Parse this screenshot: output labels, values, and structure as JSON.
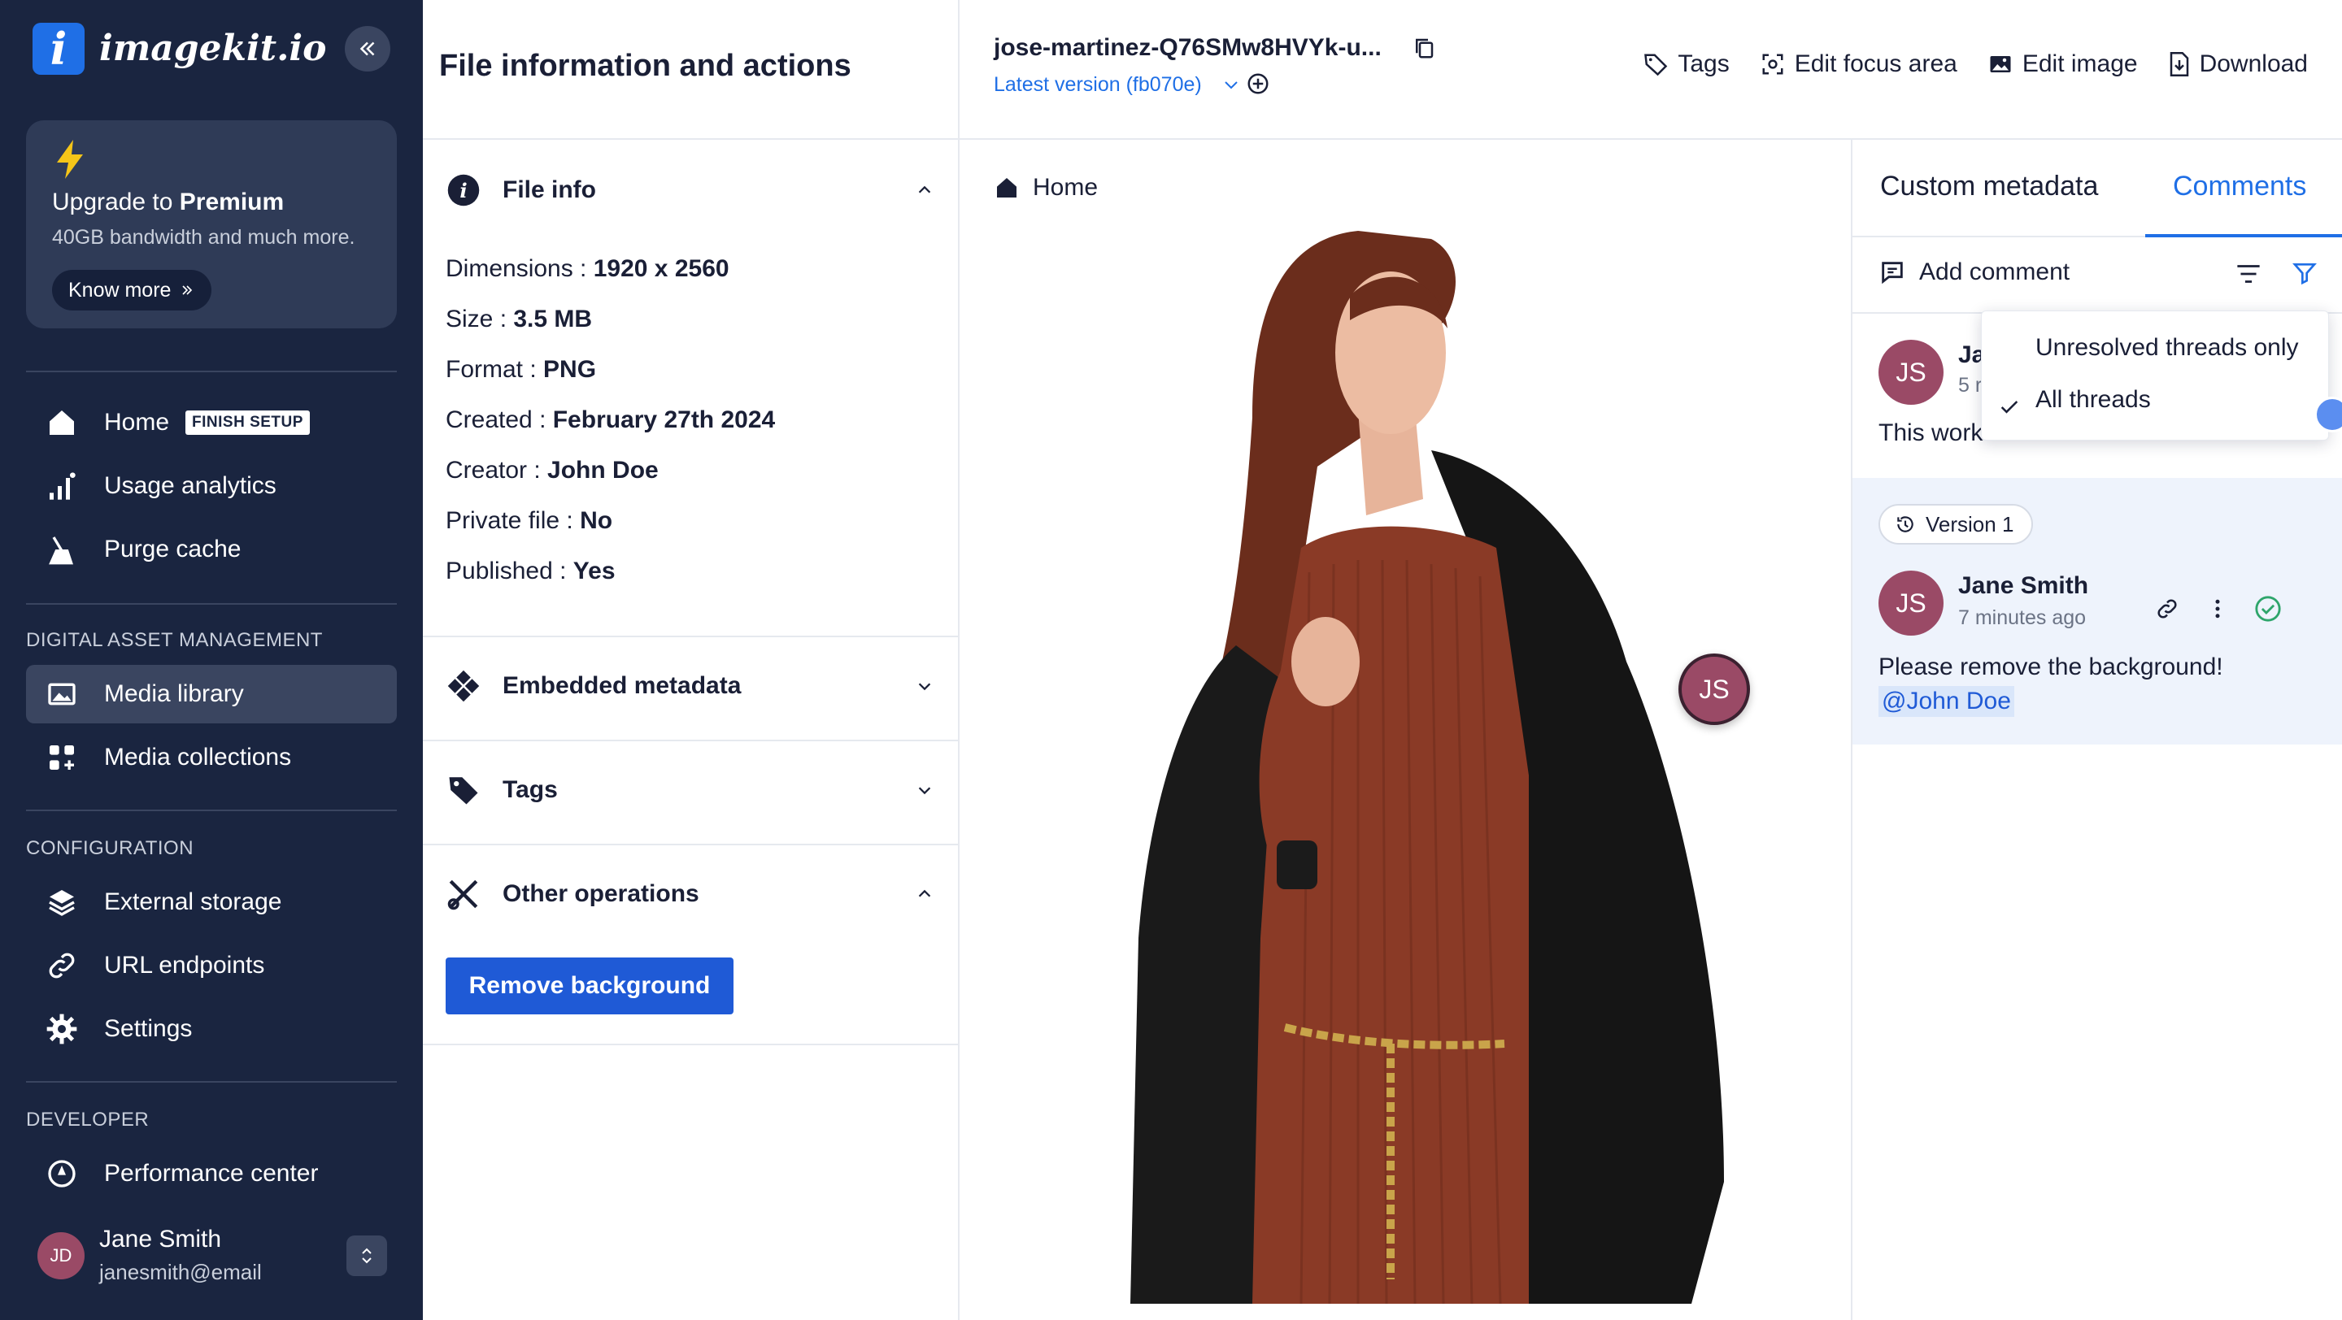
{
  "sidebar": {
    "logo_mark": "i",
    "logo_text": "imagekit.io",
    "upgrade": {
      "title_prefix": "Upgrade to ",
      "title_bold": "Premium",
      "subtitle": "40GB bandwidth and much more.",
      "button": "Know more"
    },
    "nav_main": [
      {
        "label": "Home",
        "badge": "FINISH SETUP",
        "icon": "home-icon"
      },
      {
        "label": "Usage analytics",
        "icon": "analytics-icon"
      },
      {
        "label": "Purge cache",
        "icon": "purge-icon"
      }
    ],
    "section_dam": "DIGITAL ASSET MANAGEMENT",
    "nav_dam": [
      {
        "label": "Media library",
        "icon": "media-library-icon",
        "active": true
      },
      {
        "label": "Media collections",
        "icon": "collections-icon"
      }
    ],
    "section_config": "CONFIGURATION",
    "nav_config": [
      {
        "label": "External storage",
        "icon": "storage-icon"
      },
      {
        "label": "URL endpoints",
        "icon": "link-icon"
      },
      {
        "label": "Settings",
        "icon": "gear-icon"
      }
    ],
    "section_dev": "DEVELOPER",
    "nav_dev": [
      {
        "label": "Performance center",
        "icon": "performance-icon"
      }
    ],
    "user": {
      "initials": "JD",
      "name": "Jane Smith",
      "email": "janesmith@email"
    }
  },
  "info_panel": {
    "title": "File information and actions",
    "file_info": {
      "heading": "File info",
      "rows": [
        {
          "label": "Dimensions : ",
          "value": "1920 x 2560"
        },
        {
          "label": "Size : ",
          "value": "3.5 MB"
        },
        {
          "label": "Format : ",
          "value": "PNG"
        },
        {
          "label": "Created : ",
          "value": "February 27th 2024"
        },
        {
          "label": "Creator : ",
          "value": "John Doe"
        },
        {
          "label": "Private file : ",
          "value": "No"
        },
        {
          "label": "Published : ",
          "value": "Yes"
        }
      ]
    },
    "embedded_metadata": "Embedded metadata",
    "tags": "Tags",
    "other_operations": "Other operations",
    "remove_background": "Remove background"
  },
  "topbar": {
    "file_name": "jose-martinez-Q76SMw8HVYk-u...",
    "version": "Latest version (fb070e)",
    "tools": {
      "tags": "Tags",
      "focus": "Edit focus area",
      "edit": "Edit image",
      "download": "Download"
    }
  },
  "viewer": {
    "breadcrumb": "Home",
    "pin_initials": "JS"
  },
  "comments": {
    "tab_metadata": "Custom metadata",
    "tab_comments": "Comments",
    "add_comment": "Add comment",
    "thread1": {
      "initials": "JS",
      "name_partial": "Ja",
      "time_partial": "5 r",
      "text_partial": "This work"
    },
    "dropdown": {
      "option1": "Unresolved threads only",
      "option2": "All threads"
    },
    "thread2": {
      "version": "Version 1",
      "initials": "JS",
      "name": "Jane Smith",
      "time": "7 minutes ago",
      "text": "Please remove the background!",
      "mention": "@John Doe"
    }
  },
  "colors": {
    "sidebar_bg": "#1a2540",
    "accent": "#1f6fe6",
    "primary_button": "#1f5ad6",
    "avatar": "#9a4a66"
  }
}
